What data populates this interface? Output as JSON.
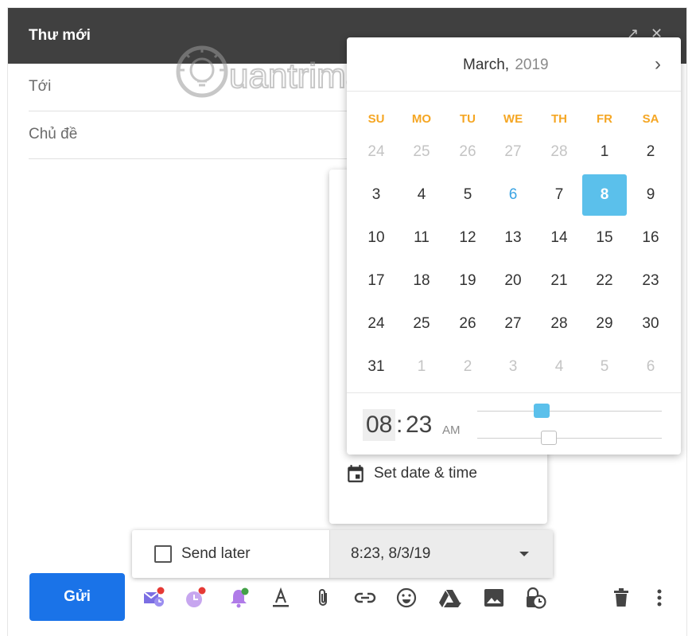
{
  "compose": {
    "title": "Thư mới",
    "to_label": "Tới",
    "subject_label": "Chủ đề",
    "send_label": "Gửi"
  },
  "watermark": {
    "text": "uantrimang"
  },
  "calendar": {
    "month": "March,",
    "year": "2019",
    "weekdays": [
      "SU",
      "MO",
      "TU",
      "WE",
      "TH",
      "FR",
      "SA"
    ],
    "weeks": [
      [
        "24",
        "25",
        "26",
        "27",
        "28",
        "1",
        "2"
      ],
      [
        "3",
        "4",
        "5",
        "6",
        "7",
        "8",
        "9"
      ],
      [
        "10",
        "11",
        "12",
        "13",
        "14",
        "15",
        "16"
      ],
      [
        "17",
        "18",
        "19",
        "20",
        "21",
        "22",
        "23"
      ],
      [
        "24",
        "25",
        "26",
        "27",
        "28",
        "29",
        "30"
      ],
      [
        "31",
        "1",
        "2",
        "3",
        "4",
        "5",
        "6"
      ]
    ],
    "selected_day": "8",
    "today_day": "6",
    "hour": "08",
    "minute": "23",
    "ampm": "AM",
    "hour_slider": 0.35,
    "minute_slider": 0.39
  },
  "dropdown": {
    "set_date_time_label": "Set date & time"
  },
  "send_later": {
    "label": "Send later",
    "checked": false,
    "schedule_value": "8:23, 8/3/19"
  },
  "colors": {
    "header_bg": "#404040",
    "accent_blue": "#1a73e8",
    "selected_day_bg": "#5bc0eb",
    "weekday_orange": "#f5a623"
  },
  "toolbar_icons": [
    "schedule-send-icon",
    "reminder-icon",
    "notification-bell-icon",
    "text-format-icon",
    "attach-file-icon",
    "insert-link-icon",
    "emoji-icon",
    "google-drive-icon",
    "insert-photo-icon",
    "confidential-mode-icon",
    "trash-icon",
    "more-options-icon"
  ]
}
